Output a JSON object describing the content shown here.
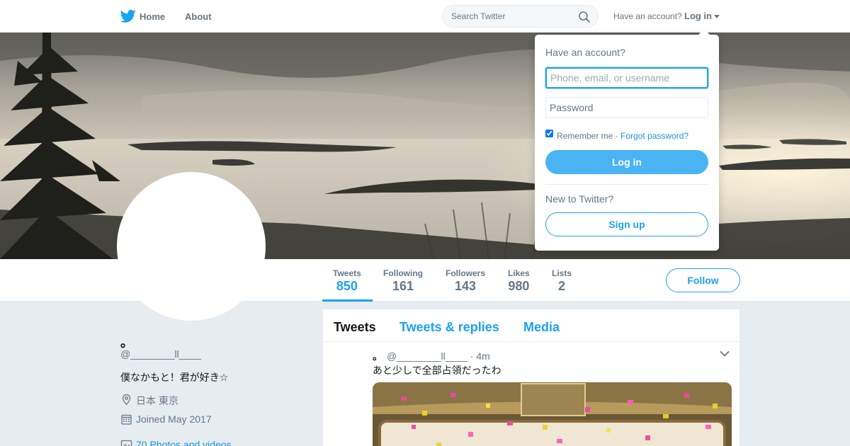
{
  "colors": {
    "brand": "#1da1f2",
    "text_primary": "#14171a",
    "text_secondary": "#657786",
    "page_bg": "#e6ecf0"
  },
  "nav": {
    "logo_icon": "twitter-bird-icon",
    "home_label": "Home",
    "about_label": "About",
    "search_placeholder": "Search Twitter",
    "search_icon": "magnifier-icon",
    "have_account_label": "Have an account?",
    "login_label": "Log in",
    "login_caret_icon": "chevron-down-icon"
  },
  "profile": {
    "name": "。",
    "handle": "@________ll____",
    "bio": "僕なかもと！君が好き☆",
    "location": "日本 東京",
    "location_icon": "location-pin-icon",
    "joined": "Joined May 2017",
    "joined_icon": "calendar-icon",
    "photos_link": "70 Photos and videos",
    "photos_icon": "photo-icon"
  },
  "stats": [
    {
      "label": "Tweets",
      "value": "850"
    },
    {
      "label": "Following",
      "value": "161"
    },
    {
      "label": "Followers",
      "value": "143"
    },
    {
      "label": "Likes",
      "value": "980"
    },
    {
      "label": "Lists",
      "value": "2"
    }
  ],
  "follow_label": "Follow",
  "timeline": {
    "tabs": [
      "Tweets",
      "Tweets & replies",
      "Media"
    ],
    "tweet": {
      "author_name": "。",
      "author_handle": "@________ll____",
      "time": "· 4m",
      "text": "あと少しで全部占領だったわ"
    }
  },
  "login_dropdown": {
    "title": "Have an account?",
    "username_placeholder": "Phone, email, or username",
    "password_placeholder": "Password",
    "remember_label": "Remember me · ",
    "forgot_label": "Forgot password?",
    "remember_checked": true,
    "login_button": "Log in",
    "new_label": "New to Twitter?",
    "signup_button": "Sign up"
  }
}
